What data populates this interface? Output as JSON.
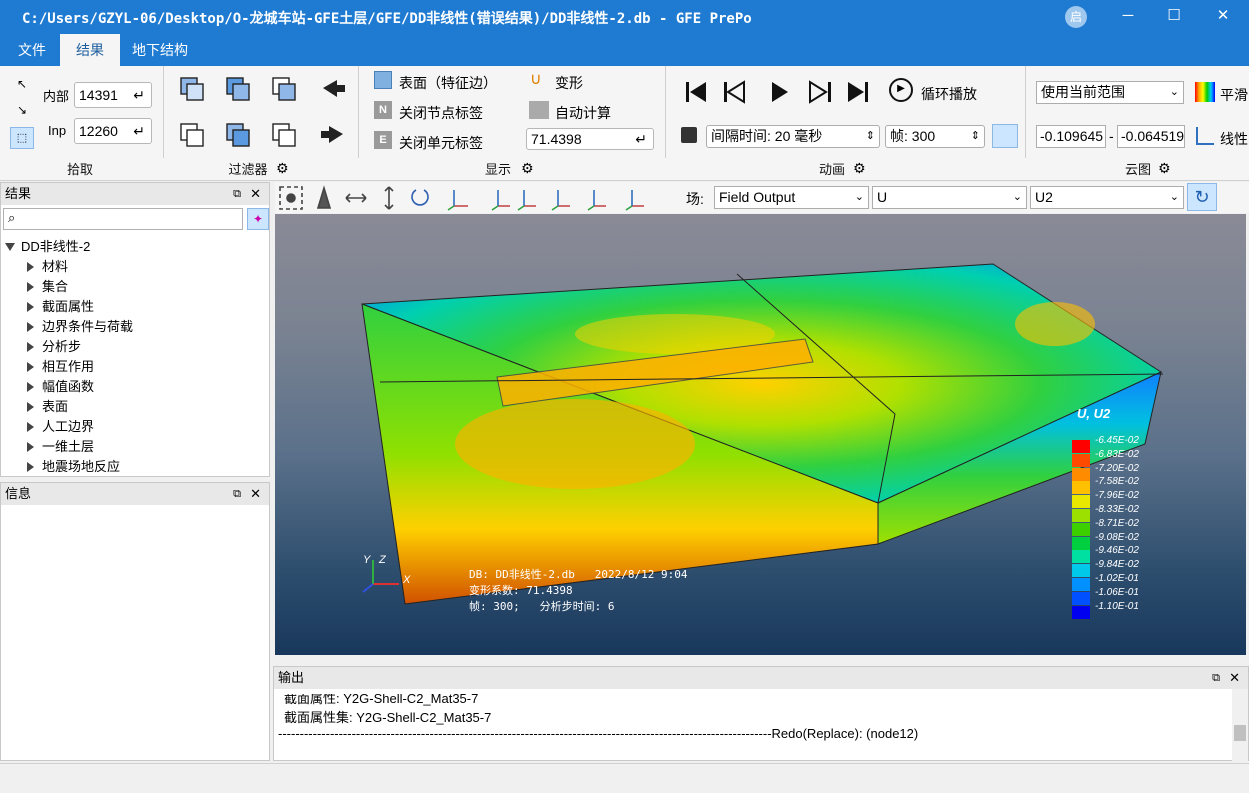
{
  "window": {
    "title": "C:/Users/GZYL-06/Desktop/O-龙城车站-GFE土层/GFE/DD非线性(错误结果)/DD非线性-2.db - GFE PrePo",
    "user_badge": "启",
    "min": "─",
    "max": "☐",
    "close": "✕"
  },
  "menu": [
    "文件",
    "结果",
    "地下结构"
  ],
  "pick": {
    "inner_label": "内部",
    "inner_value": "14391",
    "inp_label": "Inp",
    "inp_value": "12260",
    "group": "拾取",
    "filter": "过滤器"
  },
  "display": {
    "surface": "表面（特征边）",
    "node_label": "关闭节点标签",
    "elem_label": "关闭单元标签",
    "deform": "变形",
    "auto_calc": "自动计算",
    "deform_value": "71.4398",
    "group": "显示"
  },
  "anim": {
    "loop": "循环播放",
    "interval_label": "间隔时间:",
    "interval_value": "20 毫秒",
    "frame_label": "帧:",
    "frame_value": "300",
    "group": "动画"
  },
  "cloud": {
    "range": "使用当前范围",
    "smooth": "平滑",
    "min_value": "-0.109645",
    "dash": "-",
    "max_value": "-0.064519",
    "linear": "线性",
    "group": "云图"
  },
  "results_panel": {
    "title": "结果",
    "search_placeholder": "",
    "root": "DD非线性-2",
    "items": [
      "材料",
      "集合",
      "截面属性",
      "边界条件与荷载",
      "分析步",
      "相互作用",
      "幅值函数",
      "表面",
      "人工边界",
      "一维土层",
      "地震场地反应"
    ]
  },
  "info_panel": {
    "title": "信息"
  },
  "viewport_toolbar": {
    "field_label": "场:",
    "field": "Field Output",
    "var": "U",
    "comp": "U2"
  },
  "viewport": {
    "legend_title": "U, U2",
    "legend": [
      "-6.45E-02",
      "-6.83E-02",
      "-7.20E-02",
      "-7.58E-02",
      "-7.96E-02",
      "-8.33E-02",
      "-8.71E-02",
      "-9.08E-02",
      "-9.46E-02",
      "-9.84E-02",
      "-1.02E-01",
      "-1.06E-01",
      "-1.10E-01"
    ],
    "info_db": "DB: DD非线性-2.db",
    "info_date": "2022/8/12 9:04",
    "info_scale": "变形系数:  71.4398",
    "info_frame": "帧:  300;",
    "info_time": "分析步时间:  6",
    "axis_x": "X",
    "axis_y": "Y",
    "axis_z": "Z"
  },
  "chart_data": {
    "type": "heatmap",
    "title": "U, U2",
    "legend_levels": [
      -0.0645,
      -0.0683,
      -0.072,
      -0.0758,
      -0.0796,
      -0.0833,
      -0.0871,
      -0.0908,
      -0.0946,
      -0.0984,
      -0.102,
      -0.106,
      -0.11
    ],
    "legend_colors": [
      "#ff0000",
      "#ff4a00",
      "#ff8c00",
      "#ffc000",
      "#e8e800",
      "#9ce000",
      "#3cd000",
      "#00d040",
      "#00e0a0",
      "#00c8e8",
      "#0090ff",
      "#0050ff",
      "#0000f0"
    ]
  },
  "output": {
    "title": "输出",
    "line1": "截面属性:  Y2G-Shell-C2_Mat35-7",
    "line2": "截面属性集:  Y2G-Shell-C2_Mat35-7",
    "line3": "------------------------------------------------------------------------------------------------------------------Redo(Replace): (node12)"
  }
}
